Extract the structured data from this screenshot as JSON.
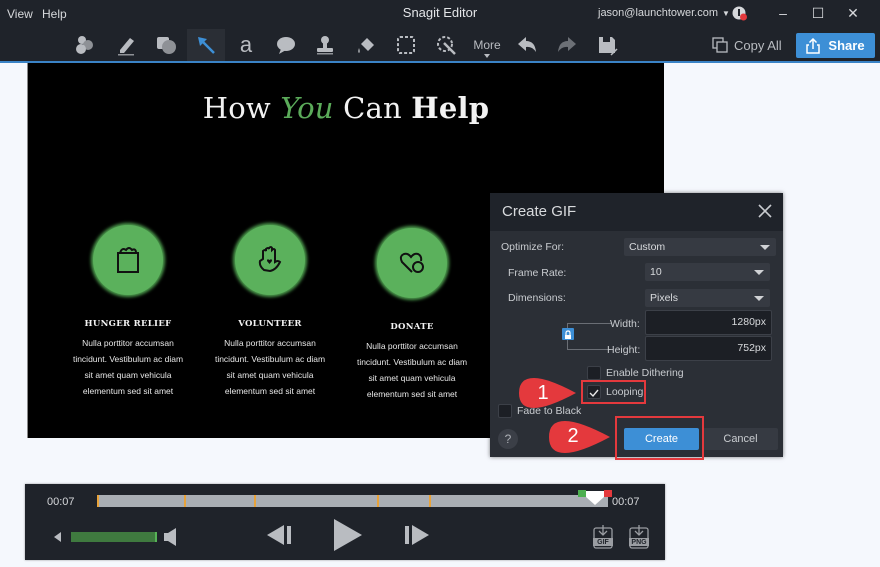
{
  "window": {
    "title": "Snagit Editor",
    "menu": [
      "View",
      "Help"
    ],
    "account": "jason@launchtower.com",
    "controls": [
      "minimize",
      "maximize",
      "close"
    ]
  },
  "toolbar": {
    "tools": [
      {
        "name": "step-tool",
        "icon": "step-icon"
      },
      {
        "name": "highlighter-tool",
        "icon": "highlighter-icon"
      },
      {
        "name": "shape-tool",
        "icon": "shape-icon"
      },
      {
        "name": "arrow-tool",
        "icon": "arrow-icon",
        "active": true
      },
      {
        "name": "text-tool",
        "icon": "text-icon",
        "glyph": "a"
      },
      {
        "name": "callout-tool",
        "icon": "speech-bubble-icon"
      },
      {
        "name": "stamp-tool",
        "icon": "stamp-icon"
      },
      {
        "name": "fill-tool",
        "icon": "paint-bucket-icon"
      },
      {
        "name": "selection-tool",
        "icon": "marquee-icon"
      },
      {
        "name": "magic-wand-tool",
        "icon": "magic-wand-icon"
      }
    ],
    "more_label": "More",
    "copy_all_label": "Copy All",
    "share_label": "Share"
  },
  "canvas": {
    "headline": {
      "part1": "How ",
      "part2": "You",
      "part3": " Can ",
      "part4": "Help"
    },
    "columns": [
      {
        "title": "HUNGER RELIEF",
        "icon": "shopping-bag-icon",
        "lines": [
          "Nulla porttitor accumsan",
          "tincidunt. Vestibulum ac diam",
          "sit amet quam vehicula",
          "elementum sed sit amet"
        ]
      },
      {
        "title": "VOLUNTEER",
        "icon": "hand-heart-icon",
        "lines": [
          "Nulla porttitor accumsan",
          "tincidunt. Vestibulum ac diam",
          "sit amet quam vehicula",
          "elementum sed sit amet"
        ]
      },
      {
        "title": "DONATE",
        "icon": "heart-coin-icon",
        "lines": [
          "Nulla porttitor accumsan",
          "tincidunt. Vestibulum ac diam",
          "sit amet quam vehicula",
          "elementum sed sit amet"
        ]
      }
    ]
  },
  "dialog": {
    "title": "Create GIF",
    "optimize_label": "Optimize For:",
    "optimize_value": "Custom",
    "frame_rate_label": "Frame Rate:",
    "frame_rate_value": "10",
    "dimensions_label": "Dimensions:",
    "dimensions_value": "Pixels",
    "width_label": "Width:",
    "width_value": "1280px",
    "height_label": "Height:",
    "height_value": "752px",
    "dithering_label": "Enable Dithering",
    "dithering_checked": false,
    "looping_label": "Looping",
    "looping_checked": true,
    "fade_label": "Fade to Black",
    "fade_checked": false,
    "help_label": "?",
    "create_label": "Create",
    "cancel_label": "Cancel"
  },
  "annotations": [
    {
      "number": "1",
      "target": "Looping"
    },
    {
      "number": "2",
      "target": "Create"
    }
  ],
  "player": {
    "time_start": "00:07",
    "time_end": "00:07",
    "gif_label": "GIF",
    "png_label": "PNG"
  },
  "colors": {
    "accent": "#3d8fd6",
    "dark_bg": "#1f232a",
    "green": "#5bb15c",
    "annotation_red": "#e4393d",
    "marker_orange": "#e8a33a"
  }
}
